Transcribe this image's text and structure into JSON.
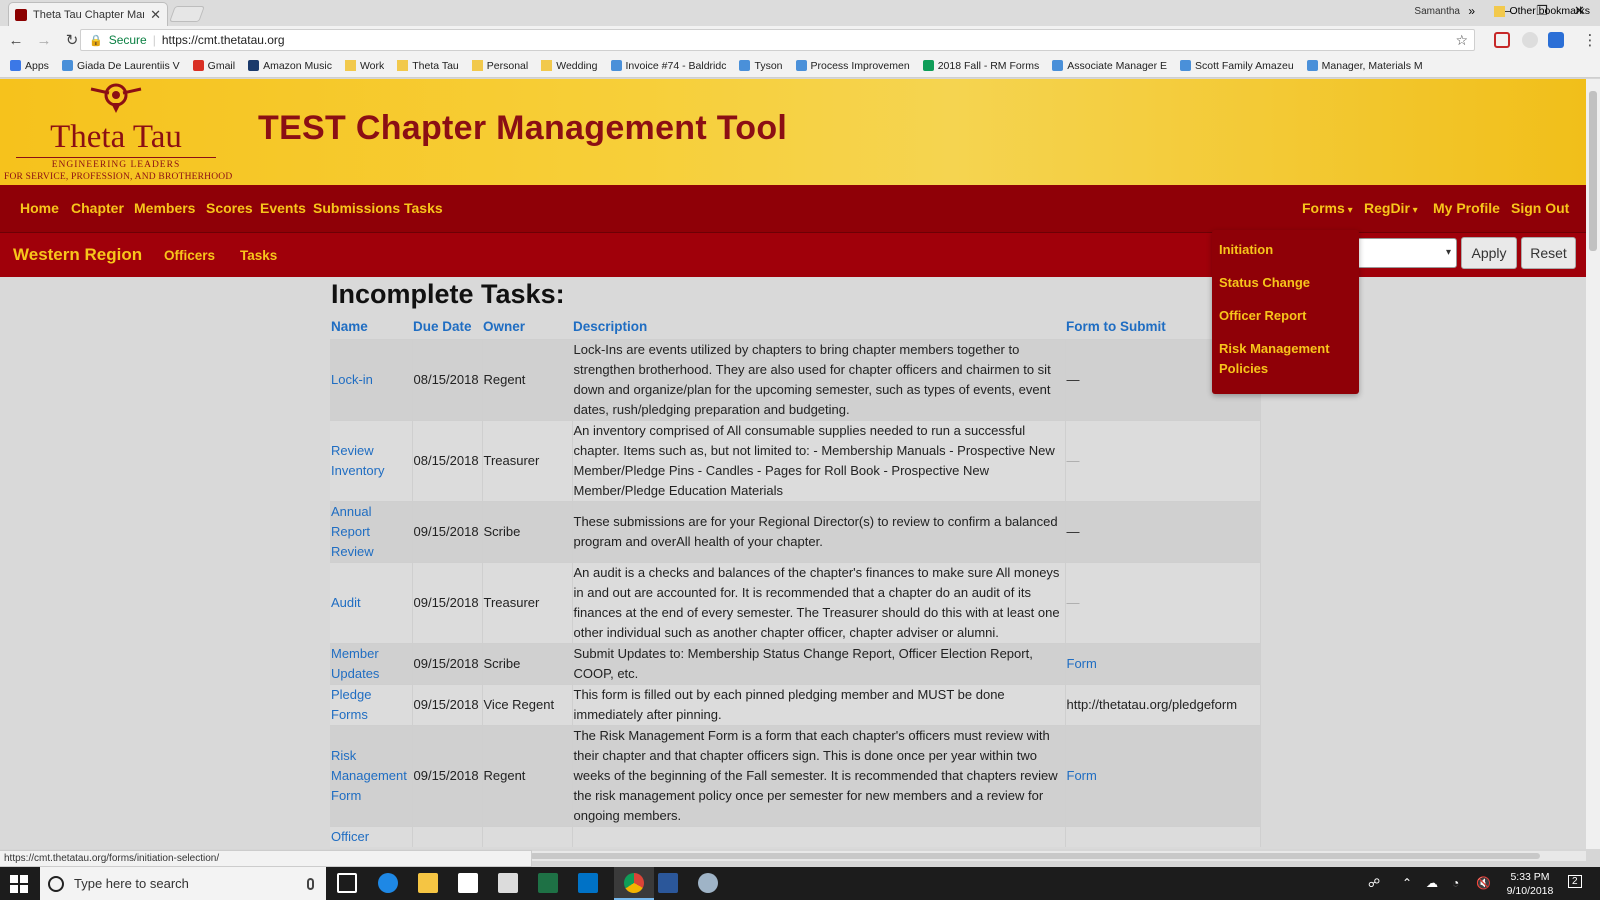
{
  "browser": {
    "tab_title": "Theta Tau Chapter Manag",
    "profile_name": "Samantha",
    "secure_label": "Secure",
    "url": "https://cmt.thetatau.org",
    "bookmarks": [
      {
        "label": "Apps",
        "icon": "apps-grid-icon"
      },
      {
        "label": "Giada De Laurentiis V",
        "icon": "site-icon"
      },
      {
        "label": "Gmail",
        "icon": "gmail-icon"
      },
      {
        "label": "Amazon Music",
        "icon": "amazon-icon"
      },
      {
        "label": "Work",
        "icon": "folder-icon"
      },
      {
        "label": "Theta Tau",
        "icon": "folder-icon"
      },
      {
        "label": "Personal",
        "icon": "folder-icon"
      },
      {
        "label": "Wedding",
        "icon": "folder-icon"
      },
      {
        "label": "Invoice #74 - Baldridc",
        "icon": "site-icon"
      },
      {
        "label": "Tyson",
        "icon": "site-icon"
      },
      {
        "label": "Process Improvemen",
        "icon": "site-icon"
      },
      {
        "label": "2018 Fall - RM Forms",
        "icon": "sheets-icon"
      },
      {
        "label": "Associate Manager E",
        "icon": "site-icon"
      },
      {
        "label": "Scott Family Amazeu",
        "icon": "site-icon"
      },
      {
        "label": "Manager, Materials M",
        "icon": "site-icon"
      }
    ],
    "bookmarks_more": "»",
    "other_bookmarks": "Other bookmarks",
    "status_url": "https://cmt.thetatau.org/forms/initiation-selection/"
  },
  "header": {
    "logo_name": "Theta Tau",
    "logo_tagline_1": "ENGINEERING LEADERS",
    "logo_tagline_2": "FOR SERVICE, PROFESSION, AND BROTHERHOOD",
    "title": "TEST Chapter Management Tool"
  },
  "nav": {
    "left": [
      "Home",
      "Chapter",
      "Members",
      "Scores",
      "Events",
      "Submissions",
      "Tasks"
    ],
    "forms": "Forms",
    "regdir": "RegDir",
    "profile": "My Profile",
    "signout": "Sign Out"
  },
  "subnav": {
    "region": "Western Region",
    "officers": "Officers",
    "tasks": "Tasks",
    "apply": "Apply",
    "reset": "Reset"
  },
  "forms_menu": [
    "Initiation",
    "Status Change",
    "Officer Report",
    "Risk Management Policies"
  ],
  "tasks": {
    "heading": "Incomplete Tasks:",
    "columns": [
      "Name",
      "Due Date",
      "Owner",
      "Description",
      "Form to Submit"
    ],
    "rows": [
      {
        "name": "Lock-in",
        "due": "08/15/2018",
        "owner": "Regent",
        "desc": "Lock-Ins are events utilized by chapters to bring chapter members together to strengthen brotherhood. They are also used for chapter officers and chairmen to sit down and organize/plan for the upcoming semester, such as types of events, event dates, rush/pledging preparation and budgeting.",
        "form": "—"
      },
      {
        "name": "Review Inventory",
        "due": "08/15/2018",
        "owner": "Treasurer",
        "desc": "An inventory comprised of All consumable supplies needed to run a successful chapter. Items such as, but not limited to: - Membership Manuals - Prospective New Member/Pledge Pins - Candles - Pages for Roll Book - Prospective New Member/Pledge Education Materials",
        "form": "—"
      },
      {
        "name": "Annual Report Review",
        "due": "09/15/2018",
        "owner": "Scribe",
        "desc": "These submissions are for your Regional Director(s) to review to confirm a balanced program and overAll health of your chapter.",
        "form": "—"
      },
      {
        "name": "Audit",
        "due": "09/15/2018",
        "owner": "Treasurer",
        "desc": "An audit is a checks and balances of the chapter's finances to make sure All moneys in and out are accounted for. It is recommended that a chapter do an audit of its finances at the end of every semester. The Treasurer should do this with at least one other individual such as another chapter officer, chapter adviser or alumni.",
        "form": "—"
      },
      {
        "name": "Member Updates",
        "due": "09/15/2018",
        "owner": "Scribe",
        "desc": "Submit Updates to: Membership Status Change Report, Officer Election Report, COOP, etc.",
        "form": "Form"
      },
      {
        "name": "Pledge Forms",
        "due": "09/15/2018",
        "owner": "Vice Regent",
        "desc": "This form is filled out by each pinned pledging member and MUST be done immediately after pinning.",
        "form": "http://thetatau.org/pledgeform"
      },
      {
        "name": "Risk Management Form",
        "due": "09/15/2018",
        "owner": "Regent",
        "desc": "The Risk Management Form is a form that each chapter's officers must review with their chapter and that chapter officers sign. This is done once per year within two weeks of the beginning of the Fall semester. It is recommended that chapters review the risk management policy once per semester for new members and a review for ongoing members.",
        "form": "Form"
      },
      {
        "name": "Officer",
        "due": "",
        "owner": "",
        "desc": "",
        "form": ""
      }
    ]
  },
  "taskbar": {
    "search_placeholder": "Type here to search",
    "time": "5:33 PM",
    "date": "9/10/2018",
    "notification_count": "2"
  },
  "colors": {
    "brand_red": "#8f0007",
    "brand_gold": "#f7c51b",
    "link_blue": "#1f6dc2"
  }
}
